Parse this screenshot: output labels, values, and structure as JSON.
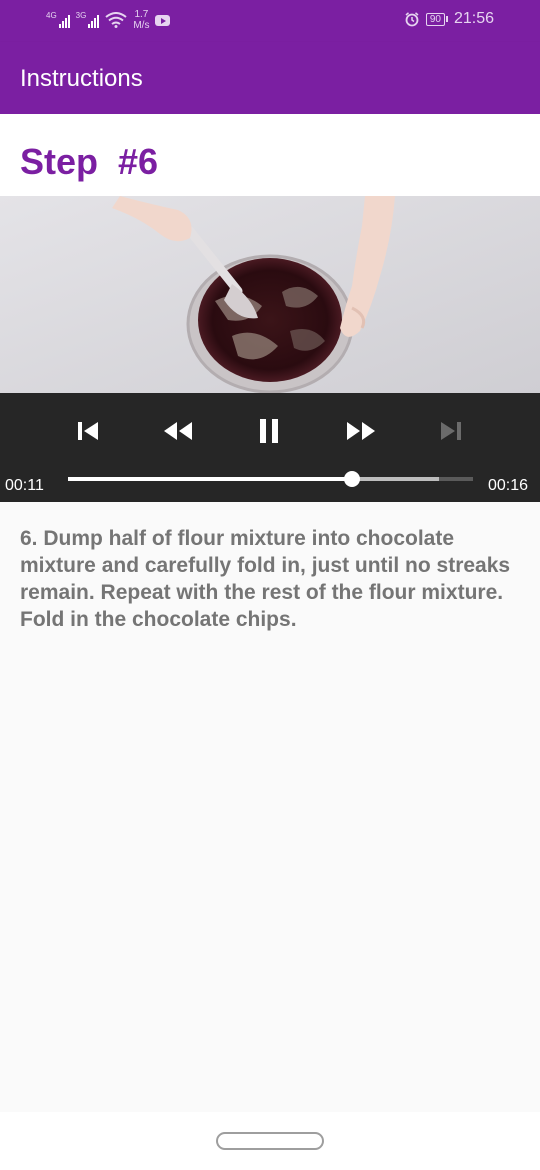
{
  "status_bar": {
    "network_1": "4G",
    "network_2": "3G",
    "speed_value": "1.7",
    "speed_unit": "M/s",
    "battery": "90",
    "time": "21:56",
    "icons": [
      "signal-icon",
      "signal-icon",
      "wifi-icon",
      "youtube-icon",
      "alarm-icon",
      "battery-icon"
    ]
  },
  "app_bar": {
    "title": "Instructions",
    "color": "#7b1fa2"
  },
  "step": {
    "title": "Step  #6",
    "color": "#7b1fa2"
  },
  "player": {
    "controls": [
      "skip-previous-icon",
      "rewind-icon",
      "pause-icon",
      "fast-forward-icon",
      "skip-next-icon"
    ],
    "elapsed": "00:11",
    "duration": "00:16",
    "played_fraction": 0.7,
    "buffered_fraction": 0.915
  },
  "description": "6. Dump half of flour mixture into chocolate mixture and carefully fold in, just until no streaks remain. Repeat with the rest of the flour mixture. Fold in the chocolate chips."
}
